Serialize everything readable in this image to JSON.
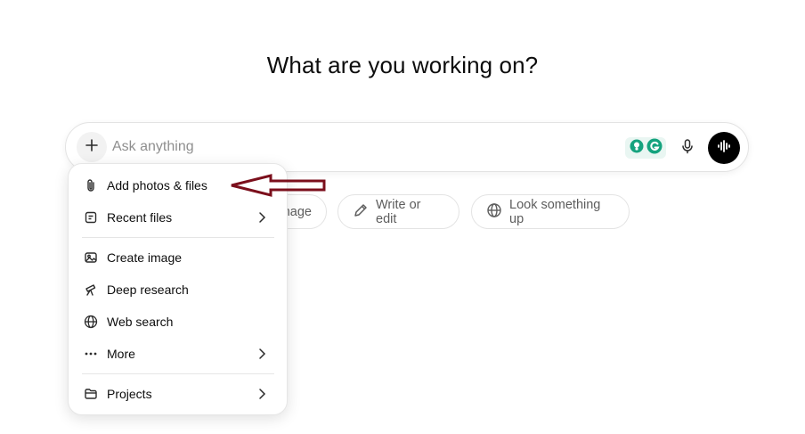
{
  "heading": "What are you working on?",
  "composer": {
    "placeholder": "Ask anything"
  },
  "chips": [
    {
      "label": "nage",
      "icon": "image-icon"
    },
    {
      "label": "Write or edit",
      "icon": "pencil-icon"
    },
    {
      "label": "Look something up",
      "icon": "globe-icon"
    }
  ],
  "menu": {
    "items": [
      {
        "label": "Add photos & files",
        "icon": "paperclip-icon"
      },
      {
        "label": "Recent files",
        "icon": "document-icon",
        "submenu": true
      },
      {
        "label": "Create image",
        "icon": "image-icon"
      },
      {
        "label": "Deep research",
        "icon": "telescope-icon"
      },
      {
        "label": "Web search",
        "icon": "globe-icon"
      },
      {
        "label": "More",
        "icon": "ellipsis-icon",
        "submenu": true
      },
      {
        "label": "Projects",
        "icon": "folder-icon",
        "submenu": true
      }
    ]
  },
  "colors": {
    "annotation_arrow": "#7b0f1c",
    "badge_green": "#15a37e",
    "voice_button": "#000000"
  }
}
